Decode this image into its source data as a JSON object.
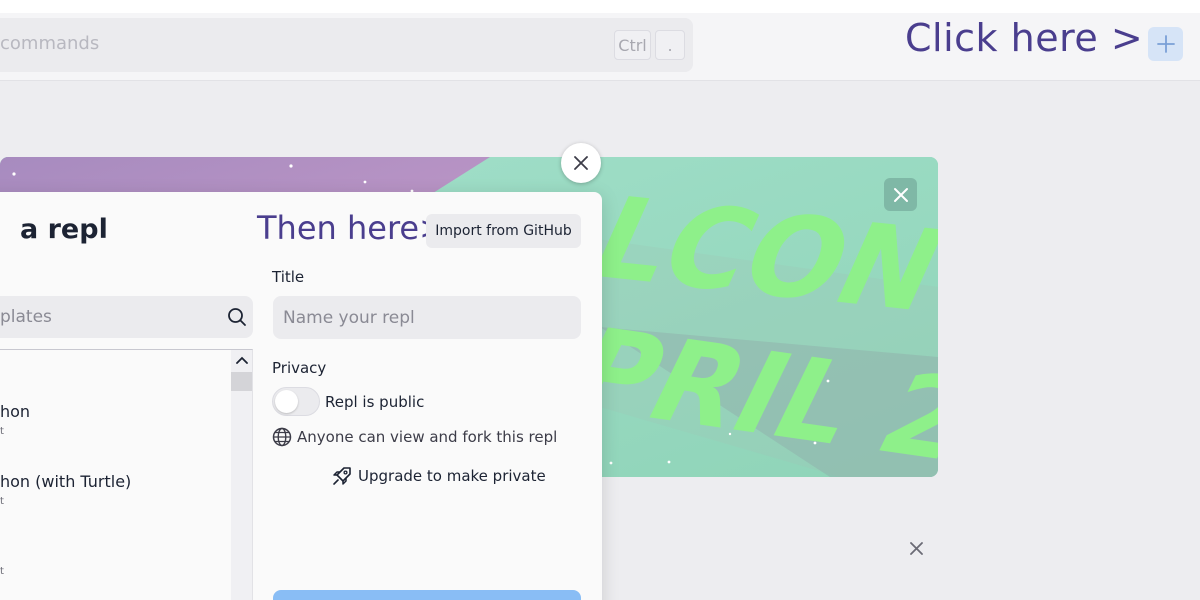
{
  "topbar": {
    "search_placeholder": "commands",
    "shortcut_keys": [
      "Ctrl",
      "."
    ],
    "annotation": "Click here >",
    "plus_icon": "plus-icon"
  },
  "banner": {
    "text_line1": "LCON",
    "text_line2": "PRIL 2",
    "colors": {
      "purple": "#b895c6",
      "green": "#9bd7c1",
      "text": "#8ef08a"
    }
  },
  "modal": {
    "title": "a repl",
    "annotation": "Then here>",
    "import_label": "Import from GitHub",
    "search_placeholder": "plates",
    "templates": [
      {
        "name": "hon",
        "sub": "t"
      },
      {
        "name": "hon (with Turtle)",
        "sub": "t"
      },
      {
        "name": "",
        "sub": "t"
      }
    ],
    "title_label": "Title",
    "title_placeholder": "Name your repl",
    "privacy_label": "Privacy",
    "toggle_label": "Repl is public",
    "public_note": "Anyone can view and fork this repl",
    "upgrade_label": "Upgrade to make private"
  },
  "colors": {
    "annotation": "#4a3e8e",
    "create_button": "#89bdf5",
    "plus_button": "#d6e4f7"
  }
}
